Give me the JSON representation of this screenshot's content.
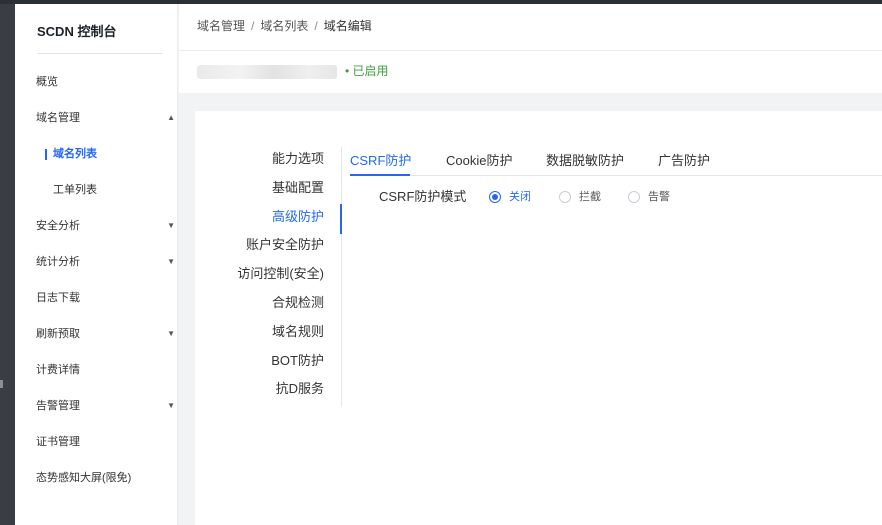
{
  "sidebar": {
    "brand": "SCDN 控制台",
    "items": [
      {
        "label": "概览",
        "arrow": ""
      },
      {
        "label": "域名管理",
        "arrow": "▲"
      },
      {
        "label": "安全分析",
        "arrow": "▼"
      },
      {
        "label": "统计分析",
        "arrow": "▼"
      },
      {
        "label": "日志下载",
        "arrow": ""
      },
      {
        "label": "刷新预取",
        "arrow": "▼"
      },
      {
        "label": "计费详情",
        "arrow": ""
      },
      {
        "label": "告警管理",
        "arrow": "▼"
      },
      {
        "label": "证书管理",
        "arrow": ""
      },
      {
        "label": "态势感知大屏(限免)",
        "arrow": ""
      }
    ],
    "submenu": [
      "域名列表",
      "工单列表"
    ]
  },
  "breadcrumb": {
    "items": [
      "域名管理",
      "域名列表",
      "域名编辑"
    ],
    "separator": "/"
  },
  "domain_status": "• 已启用",
  "side_tabs": [
    "能力选项",
    "基础配置",
    "高级防护",
    "账户安全防护",
    "访问控制(安全)",
    "合规检测",
    "域名规则",
    "BOT防护",
    "抗D服务"
  ],
  "top_tabs": [
    "CSRF防护",
    "Cookie防护",
    "数据脱敏防护",
    "广告防护"
  ],
  "csrf": {
    "label": "CSRF防护模式",
    "options": [
      "关闭",
      "拦截",
      "告警"
    ],
    "selected": "关闭"
  },
  "colors": {
    "accent": "#2468f2",
    "enabled": "#3f9d3f"
  }
}
